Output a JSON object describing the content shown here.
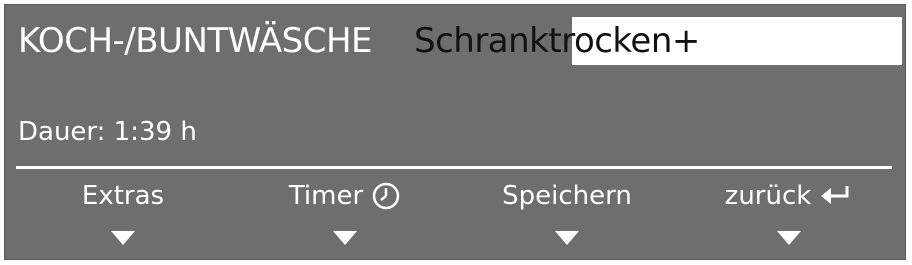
{
  "display": {
    "program": "KOCH-/BUNTWÄSCHE",
    "option": "Schranktrocken+",
    "duration": "Dauer: 1:39 h"
  },
  "softkeys": [
    {
      "label": "Extras",
      "icon": ""
    },
    {
      "label": "Timer",
      "icon": "clock-icon"
    },
    {
      "label": "Speichern",
      "icon": ""
    },
    {
      "label": "zurück",
      "icon": "return-arrow-icon"
    }
  ],
  "colors": {
    "panel": "#6e6e6e",
    "text": "#ffffff",
    "selection": "#ffffff",
    "selection_text": "#111111"
  }
}
